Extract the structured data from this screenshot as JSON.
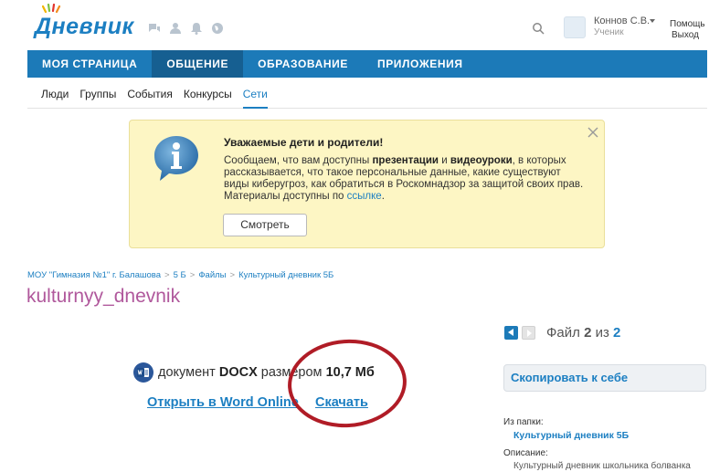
{
  "header": {
    "logo_text": "Дневник",
    "user_name": "Коннов С.В.",
    "user_role": "Ученик",
    "help_label": "Помощь",
    "exit_label": "Выход"
  },
  "nav": {
    "tabs": [
      {
        "label": "МОЯ СТРАНИЦА",
        "active": false
      },
      {
        "label": "ОБЩЕНИЕ",
        "active": true
      },
      {
        "label": "ОБРАЗОВАНИЕ",
        "active": false
      },
      {
        "label": "ПРИЛОЖЕНИЯ",
        "active": false
      }
    ],
    "sub": [
      {
        "label": "Люди",
        "active": false
      },
      {
        "label": "Группы",
        "active": false
      },
      {
        "label": "События",
        "active": false
      },
      {
        "label": "Конкурсы",
        "active": false
      },
      {
        "label": "Сети",
        "active": true
      }
    ]
  },
  "notice": {
    "title": "Уважаемые дети и родители!",
    "text_1": "Сообщаем, что вам доступны ",
    "bold_1": "презентации",
    "text_2": " и ",
    "bold_2": "видеоуроки",
    "text_3": ", в которых рассказывается, что такое персональные данные, какие существуют виды киберугроз, как обратиться в Роскомнадзор за защитой своих прав. Материалы доступны по ",
    "link": "ссылке",
    "text_4": ".",
    "button_label": "Смотреть"
  },
  "breadcrumb": [
    "МОУ \"Гимназия №1\" г. Балашова",
    "5 Б",
    "Файлы",
    "Культурный дневник 5Б"
  ],
  "breadcrumb_sep": ">",
  "page_title": "kulturnyy_dnevnik",
  "pager": {
    "prefix": "Файл",
    "current": "2",
    "of": "из",
    "total": "2"
  },
  "file": {
    "text_1": "документ",
    "format": "DOCX",
    "text_2": "размером",
    "size": "10,7 Мб",
    "open_label": "Открыть в Word Online",
    "download_label": "Скачать"
  },
  "sidebar": {
    "copy_label": "Скопировать к себе",
    "folder_label": "Из папки:",
    "folder_name": "Культурный дневник 5Б",
    "desc_label": "Описание:",
    "desc_text": "Культурный дневник школьника болванка"
  },
  "colors": {
    "brand": "#1c7fc2",
    "nav_bg": "#1c7ab8",
    "nav_active": "#165f91",
    "notice_bg": "#fdf6c4",
    "title": "#b0589c",
    "annotation": "#b01c26"
  }
}
